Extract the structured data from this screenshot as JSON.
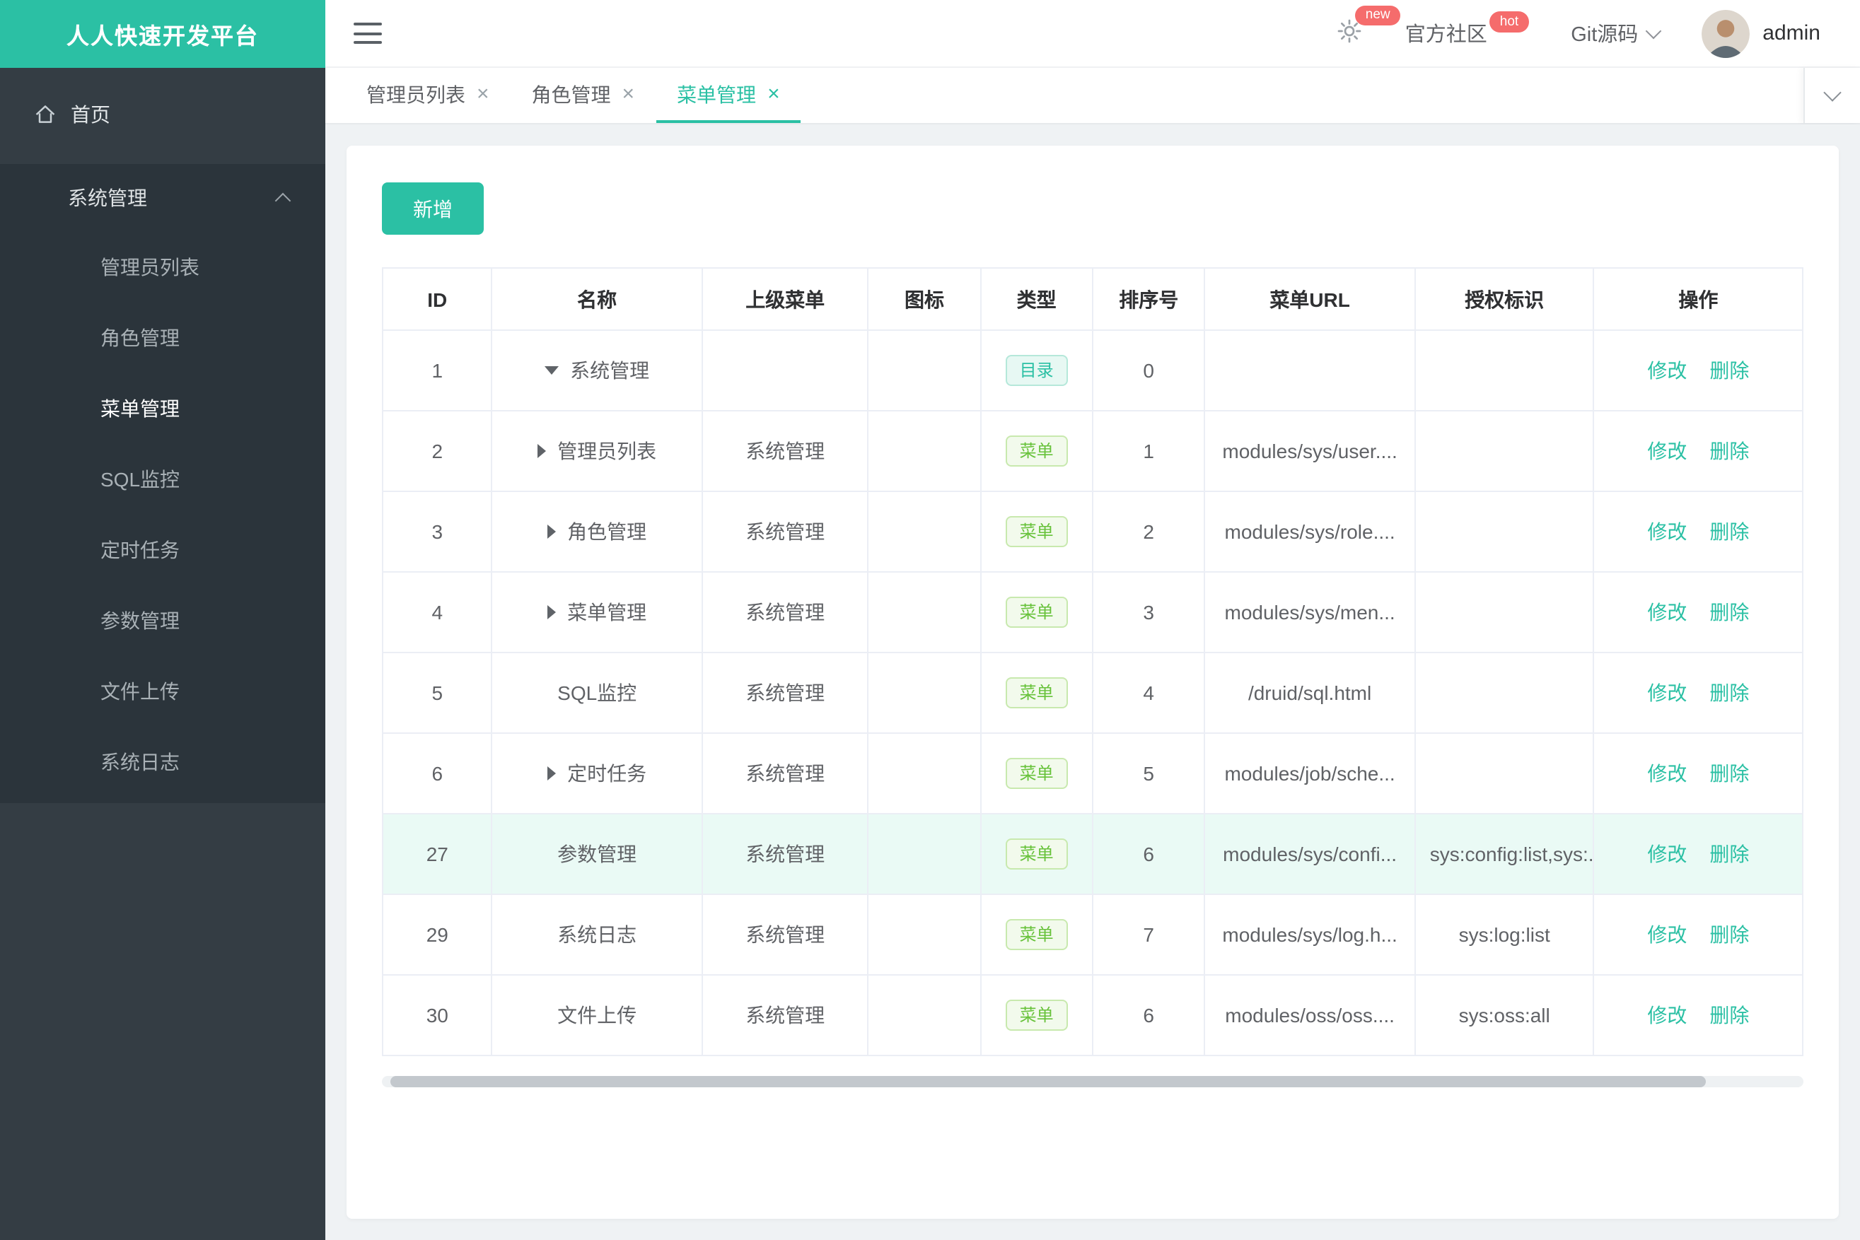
{
  "colors": {
    "brand": "#2bc0a4",
    "sidebar_bg": "#343d44",
    "sidebar_group_bg": "#2b343b",
    "badge_red": "#f56c6c",
    "tag_menu_text": "#67c23a",
    "highlight_row": "#eafaf5"
  },
  "app": {
    "title": "人人快速开发平台"
  },
  "topbar": {
    "badges": {
      "new": "new",
      "hot": "hot"
    },
    "community_label": "官方社区",
    "git_label": "Git源码",
    "username": "admin"
  },
  "sidebar": {
    "home_label": "首页",
    "group_label": "系统管理",
    "items": [
      "管理员列表",
      "角色管理",
      "菜单管理",
      "SQL监控",
      "定时任务",
      "参数管理",
      "文件上传",
      "系统日志"
    ],
    "active_item": "菜单管理"
  },
  "tabs": {
    "close_glyph": "×",
    "items": [
      {
        "label": "管理员列表",
        "active": false
      },
      {
        "label": "角色管理",
        "active": false
      },
      {
        "label": "菜单管理",
        "active": true
      }
    ]
  },
  "toolbar": {
    "add_label": "新增"
  },
  "table": {
    "columns": [
      "ID",
      "名称",
      "上级菜单",
      "图标",
      "类型",
      "排序号",
      "菜单URL",
      "授权标识",
      "操作"
    ],
    "edit_label": "修改",
    "delete_label": "删除",
    "rows": [
      {
        "id": "1",
        "arrow": "down",
        "name": "系统管理",
        "parent": "",
        "icon": "",
        "type": "目录",
        "type_kind": "dir",
        "order": "0",
        "url": "",
        "perm": "",
        "highlight": false
      },
      {
        "id": "2",
        "arrow": "right",
        "name": "管理员列表",
        "parent": "系统管理",
        "icon": "",
        "type": "菜单",
        "type_kind": "menu",
        "order": "1",
        "url": "modules/sys/user....",
        "perm": "",
        "highlight": false
      },
      {
        "id": "3",
        "arrow": "right",
        "name": "角色管理",
        "parent": "系统管理",
        "icon": "",
        "type": "菜单",
        "type_kind": "menu",
        "order": "2",
        "url": "modules/sys/role....",
        "perm": "",
        "highlight": false
      },
      {
        "id": "4",
        "arrow": "right",
        "name": "菜单管理",
        "parent": "系统管理",
        "icon": "",
        "type": "菜单",
        "type_kind": "menu",
        "order": "3",
        "url": "modules/sys/men...",
        "perm": "",
        "highlight": false
      },
      {
        "id": "5",
        "arrow": "none",
        "name": "SQL监控",
        "parent": "系统管理",
        "icon": "",
        "type": "菜单",
        "type_kind": "menu",
        "order": "4",
        "url": "/druid/sql.html",
        "perm": "",
        "highlight": false
      },
      {
        "id": "6",
        "arrow": "right",
        "name": "定时任务",
        "parent": "系统管理",
        "icon": "",
        "type": "菜单",
        "type_kind": "menu",
        "order": "5",
        "url": "modules/job/sche...",
        "perm": "",
        "highlight": false
      },
      {
        "id": "27",
        "arrow": "none",
        "name": "参数管理",
        "parent": "系统管理",
        "icon": "",
        "type": "菜单",
        "type_kind": "menu",
        "order": "6",
        "url": "modules/sys/confi...",
        "perm": "sys:config:list,sys:.",
        "highlight": true
      },
      {
        "id": "29",
        "arrow": "none",
        "name": "系统日志",
        "parent": "系统管理",
        "icon": "",
        "type": "菜单",
        "type_kind": "menu",
        "order": "7",
        "url": "modules/sys/log.h...",
        "perm": "sys:log:list",
        "highlight": false
      },
      {
        "id": "30",
        "arrow": "none",
        "name": "文件上传",
        "parent": "系统管理",
        "icon": "",
        "type": "菜单",
        "type_kind": "menu",
        "order": "6",
        "url": "modules/oss/oss....",
        "perm": "sys:oss:all",
        "highlight": false
      }
    ]
  }
}
